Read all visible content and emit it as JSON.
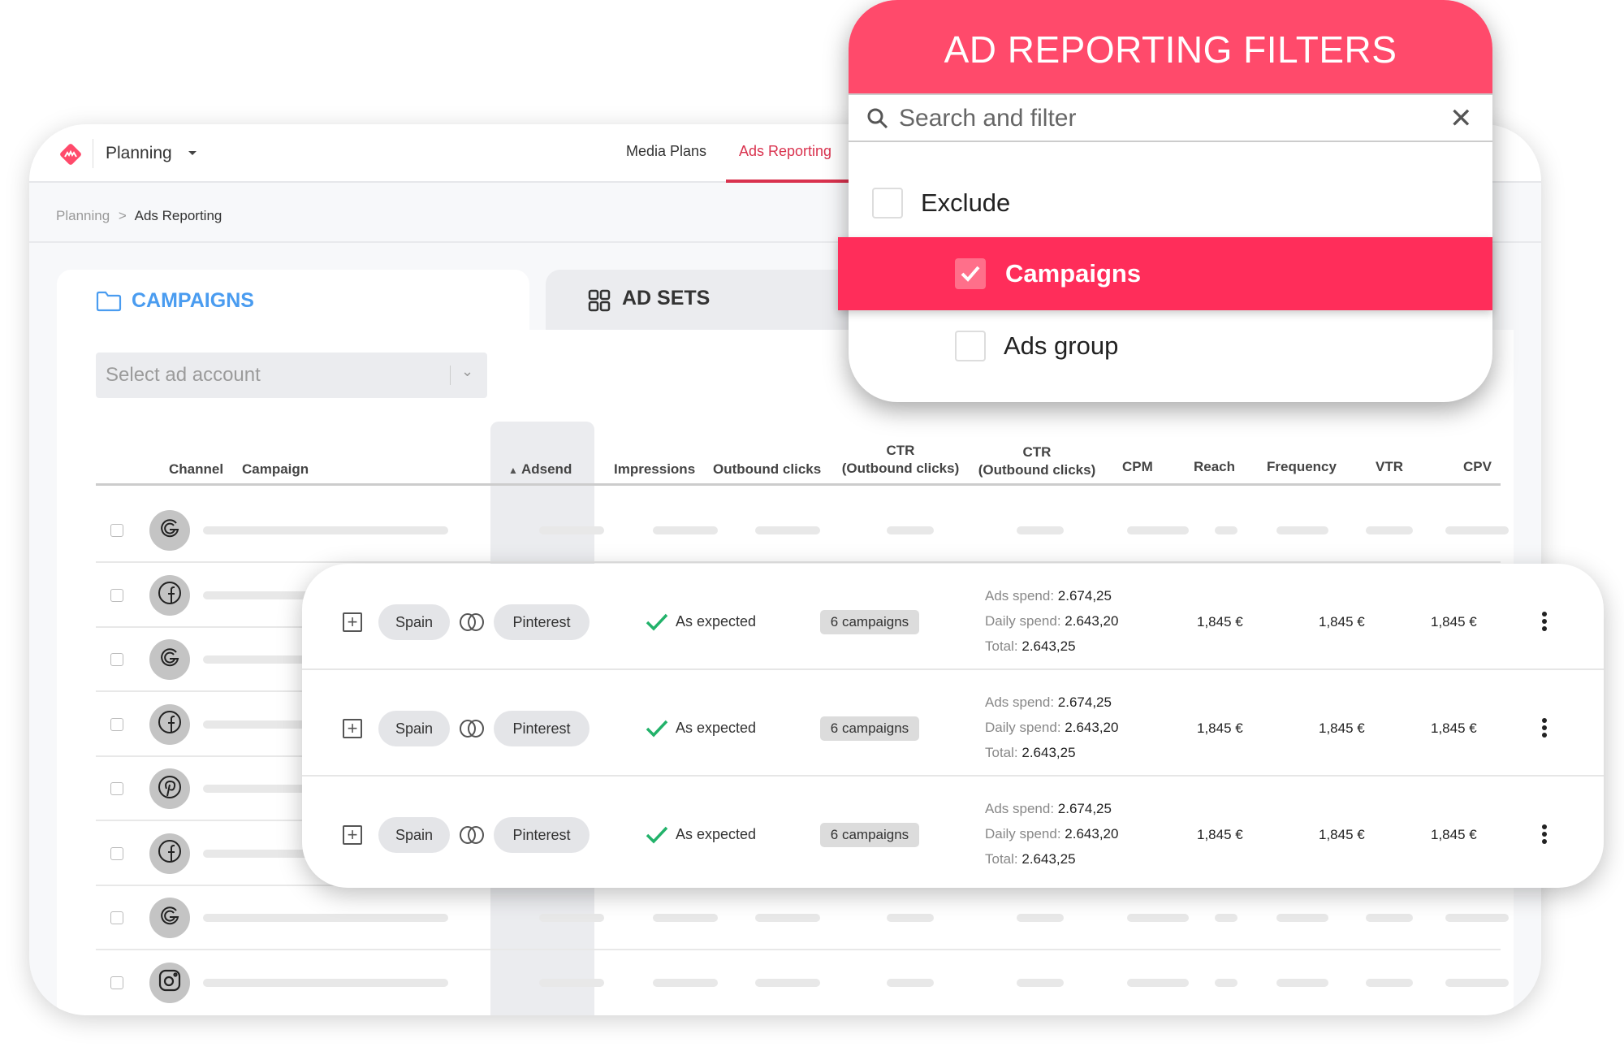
{
  "app": {
    "workspace": "Planning",
    "nav": [
      "Media Plans",
      "Ads Reporting"
    ],
    "active_nav": "Ads Reporting",
    "accent": "#d9324e"
  },
  "breadcrumb": {
    "parent": "Planning",
    "separator": ">",
    "current": "Ads Reporting"
  },
  "tabs": [
    {
      "label": "CAMPAIGNS",
      "icon": "folder-icon",
      "active": true,
      "color": "#4a9cf0"
    },
    {
      "label": "AD SETS",
      "icon": "grid-icon",
      "active": false
    }
  ],
  "ad_account_select": {
    "placeholder": "Select ad account"
  },
  "table": {
    "headers": {
      "channel": "Channel",
      "campaign": "Campaign",
      "adsend": "Adsend",
      "impressions": "Impressions",
      "outbound_clicks": "Outbound clicks",
      "ctr1_top": "CTR",
      "ctr1_bottom": "(Outbound clicks)",
      "ctr2_top": "CTR",
      "ctr2_bottom": "(Outbound clicks)",
      "cpm": "CPM",
      "reach": "Reach",
      "frequency": "Frequency",
      "vtr": "VTR",
      "cpv": "CPV"
    },
    "rows": [
      {
        "channel": "google-icon"
      },
      {
        "channel": "facebook-icon"
      },
      {
        "channel": "google-icon"
      },
      {
        "channel": "facebook-icon"
      },
      {
        "channel": "pinterest-icon"
      },
      {
        "channel": "facebook-icon"
      },
      {
        "channel": "google-icon"
      },
      {
        "channel": "instagram-icon"
      }
    ]
  },
  "overlay_rows": [
    {
      "country": "Spain",
      "platform": "Pinterest",
      "status": "As expected",
      "campaigns": "6 campaigns",
      "ads_spend_label": "Ads spend:",
      "ads_spend": "2.674,25",
      "daily_spend_label": "Daily spend:",
      "daily_spend": "2.643,20",
      "total_label": "Total:",
      "total": "2.643,25",
      "v1": "1,845 €",
      "v2": "1,845 €",
      "v3": "1,845 €"
    },
    {
      "country": "Spain",
      "platform": "Pinterest",
      "status": "As expected",
      "campaigns": "6 campaigns",
      "ads_spend_label": "Ads spend:",
      "ads_spend": "2.674,25",
      "daily_spend_label": "Daily spend:",
      "daily_spend": "2.643,20",
      "total_label": "Total:",
      "total": "2.643,25",
      "v1": "1,845 €",
      "v2": "1,845 €",
      "v3": "1,845 €"
    },
    {
      "country": "Spain",
      "platform": "Pinterest",
      "status": "As expected",
      "campaigns": "6 campaigns",
      "ads_spend_label": "Ads spend:",
      "ads_spend": "2.674,25",
      "daily_spend_label": "Daily spend:",
      "daily_spend": "2.643,20",
      "total_label": "Total:",
      "total": "2.643,25",
      "v1": "1,845 €",
      "v2": "1,845 €",
      "v3": "1,845 €"
    }
  ],
  "filter": {
    "title": "AD REPORTING FILTERS",
    "search_placeholder": "Search and filter",
    "options": [
      {
        "label": "Exclude",
        "checked": false
      },
      {
        "label": "Campaigns",
        "checked": true
      },
      {
        "label": "Ads group",
        "checked": false
      }
    ],
    "header_color": "#ff4a6b",
    "selected_color": "#ff2d5a"
  }
}
